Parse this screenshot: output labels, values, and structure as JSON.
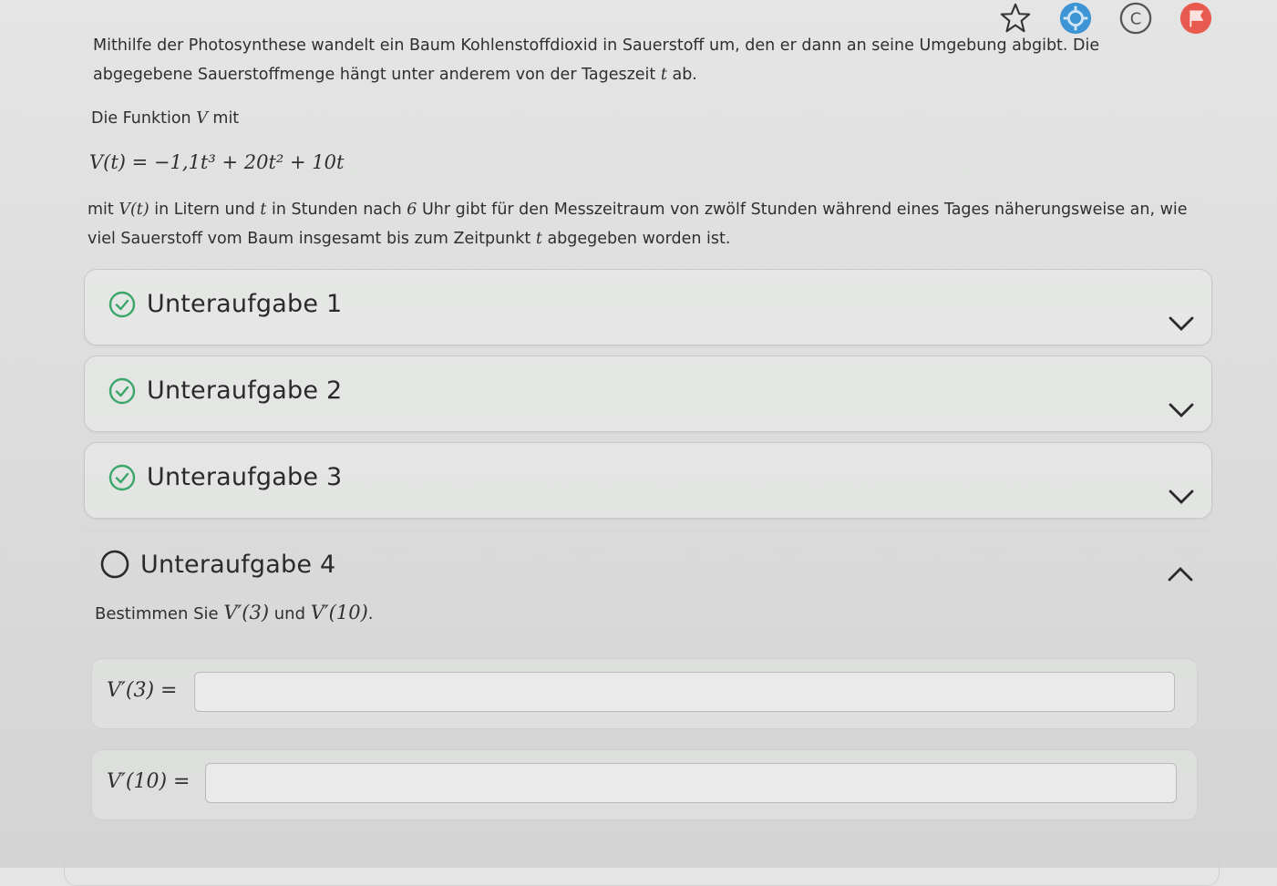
{
  "toolbar": {
    "bookmark_icon": "star-outline-icon",
    "settings_icon": "cog-badge-icon",
    "copyright_symbol": "C",
    "flag_icon": "flag-icon",
    "colors": {
      "badge_blue": "#3d95d4",
      "flag_red": "#e85a4f"
    }
  },
  "problem": {
    "intro": "Mithilfe der Photosynthese wandelt ein Baum Kohlenstoffdioxid in Sauerstoff um, den er dann an seine Umgebung abgibt. Die abgegebene Sauerstoffmenge hängt unter anderem von der Tageszeit",
    "intro_var": "t",
    "intro_end": " ab.",
    "function_pre": "Die Funktion ",
    "function_name": "V",
    "function_post": " mit",
    "formula": "V(t) = −1,1t³ + 20t² + 10t",
    "desc_1": "mit ",
    "desc_var_v": "V(t)",
    "desc_2": " in Litern und ",
    "desc_var_t": "t",
    "desc_3": " in Stunden nach ",
    "desc_six": "6",
    "desc_4": " Uhr gibt für den Messzeitraum von zwölf Stunden während eines Tages näherungsweise an, wie viel Sauerstoff vom Baum insgesamt bis zum Zeitpunkt ",
    "desc_var_t2": "t",
    "desc_5": " abgegeben worden ist."
  },
  "subtasks": [
    {
      "label": "Unteraufgabe 1",
      "status": "done",
      "expanded": false
    },
    {
      "label": "Unteraufgabe 2",
      "status": "done",
      "expanded": false
    },
    {
      "label": "Unteraufgabe 3",
      "status": "done",
      "expanded": false
    },
    {
      "label": "Unteraufgabe 4",
      "status": "open",
      "expanded": true
    }
  ],
  "task4": {
    "prompt_pre": "Bestimmen Sie ",
    "expr_a": "V′(3)",
    "prompt_mid": " und ",
    "expr_b": "V′(10)",
    "prompt_end": ".",
    "answers": [
      {
        "label": "V′(3) =",
        "value": ""
      },
      {
        "label": "V′(10) =",
        "value": ""
      }
    ]
  },
  "colors": {
    "check_green": "#3aa66a",
    "text": "#2f2f2f"
  }
}
